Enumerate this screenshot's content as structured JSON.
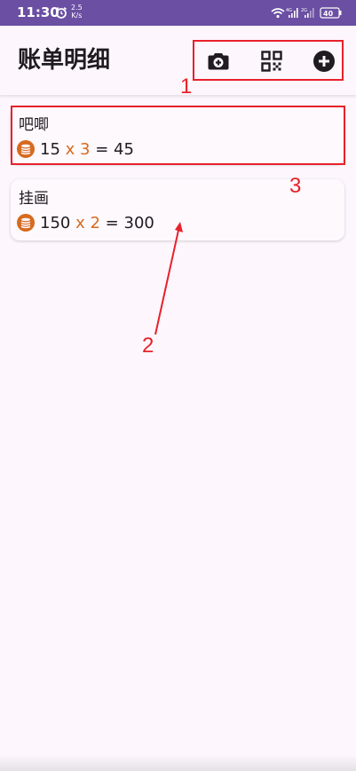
{
  "status_bar": {
    "time": "11:30",
    "net_speed_value": "2.5",
    "net_speed_unit": "K/s",
    "network_label_1": "4G",
    "network_label_2": "2G",
    "battery": "40",
    "bar_color": "#6a4fa3"
  },
  "app_bar": {
    "title": "账单明细",
    "actions": [
      {
        "icon": "camera-icon"
      },
      {
        "icon": "qr-code-icon"
      },
      {
        "icon": "add-circle-icon"
      }
    ]
  },
  "bills": [
    {
      "name": "吧唧",
      "price": "15",
      "times": "x",
      "quantity": "3",
      "equals": "=",
      "total": "45",
      "icon": "coin-stack-icon"
    },
    {
      "name": "挂画",
      "price": "150",
      "times": "x",
      "quantity": "2",
      "equals": "=",
      "total": "300",
      "icon": "coin-stack-icon"
    }
  ],
  "annotations": {
    "label_1": "1",
    "label_2": "2",
    "label_3": "3",
    "color": "#e8212b"
  },
  "colors": {
    "accent": "#d66a1e",
    "background": "#fdf7fd"
  }
}
